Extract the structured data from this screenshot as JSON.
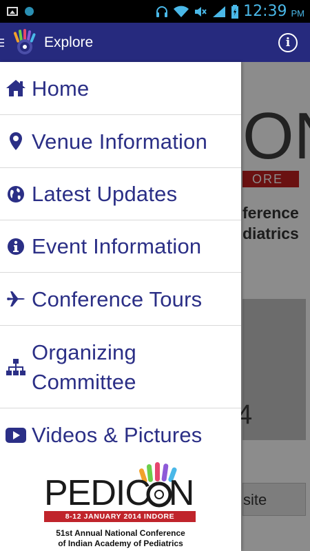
{
  "status_bar": {
    "time": "12:39",
    "ampm": "PM",
    "icons": [
      "image-icon",
      "app-dot-icon",
      "headset-icon",
      "wifi-icon",
      "mute-icon",
      "signal-icon",
      "battery-icon"
    ]
  },
  "action_bar": {
    "title": "Explore",
    "menu_icon": "menu-icon",
    "info_icon": "info-icon",
    "info_glyph": "i"
  },
  "drawer": {
    "items": [
      {
        "label": "Home",
        "icon": "home-icon"
      },
      {
        "label": "Venue Information",
        "icon": "map-marker-icon"
      },
      {
        "label": "Latest Updates",
        "icon": "globe-icon"
      },
      {
        "label": "Event Information",
        "icon": "info-circle-icon"
      },
      {
        "label": "Conference Tours",
        "icon": "plane-icon"
      },
      {
        "label": "Organizing Committee",
        "label_line1": "Organizing",
        "label_line2": "Committee",
        "icon": "sitemap-icon"
      },
      {
        "label": "Videos & Pictures",
        "icon": "video-icon"
      }
    ]
  },
  "logo": {
    "word": "PEDICON",
    "word_display": "PEDIC  N",
    "dates": "8-12 JANUARY 2014 INDORE",
    "line1": "51st Annual National Conference",
    "line2": "of Indian Academy of Pediatrics"
  },
  "background": {
    "big_text": "ON",
    "ribbon_text": "ORE",
    "line1": "ference",
    "line2": "diatrics",
    "card_text": "4",
    "site_button": "site"
  },
  "colors": {
    "primary": "#262a7e",
    "nav_text": "#2b2f86",
    "ribbon_red": "#c0242b",
    "status_accent": "#4ab8e8"
  }
}
